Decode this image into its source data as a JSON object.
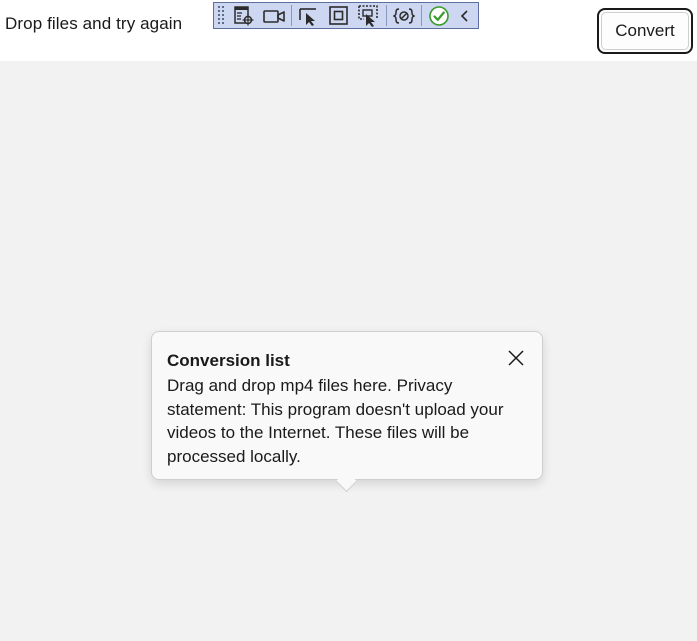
{
  "header": {
    "status_text": "Drop files and try again",
    "convert_label": "Convert"
  },
  "debug_toolbar": {
    "buttons": [
      {
        "icon": "live-visual-tree-icon"
      },
      {
        "icon": "camera-icon"
      },
      {
        "icon": "select-element-icon"
      },
      {
        "icon": "display-layout-adorners-icon"
      },
      {
        "icon": "track-focus-icon"
      },
      {
        "icon": "binding-failures-icon"
      },
      {
        "icon": "check-circle-icon"
      },
      {
        "icon": "collapse-chevron-icon"
      }
    ],
    "colors": {
      "background": "#cdd7f1",
      "border": "#5e6f9e",
      "check": "#3a9a2a"
    }
  },
  "tooltip": {
    "title": "Conversion list",
    "body": "Drag and drop mp4 files here. Privacy statement: This program doesn't upload your videos to the Internet. These files will be processed locally.",
    "close_icon": "close-icon"
  }
}
